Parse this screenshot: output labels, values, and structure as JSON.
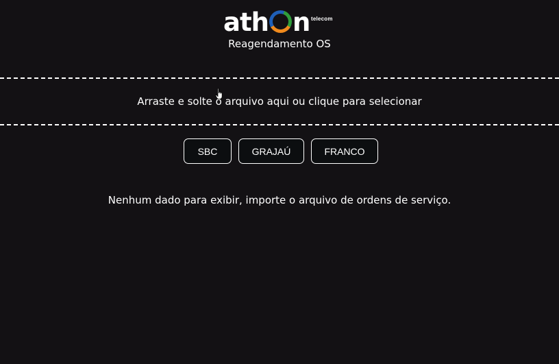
{
  "brand": {
    "logo_text_before": "ath",
    "logo_text_after": "n",
    "logo_sub": "telecom",
    "logo_colors": [
      "#2f9e3b",
      "#f08a1d",
      "#1f5fb8"
    ]
  },
  "header": {
    "title": "Reagendamento OS"
  },
  "dropzone": {
    "label": "Arraste e solte o arquivo aqui ou clique para selecionar"
  },
  "filters": {
    "buttons": [
      {
        "label": "SBC"
      },
      {
        "label": "GRAJAÚ"
      },
      {
        "label": "FRANCO"
      }
    ]
  },
  "results": {
    "empty_message": "Nenhum dado para exibir, importe o arquivo de ordens de serviço."
  },
  "theme": {
    "background": "#131114",
    "text": "#ffffff",
    "button_bg": "#0c0e10"
  },
  "icons": {
    "cursor": "hand-pointer-icon"
  }
}
